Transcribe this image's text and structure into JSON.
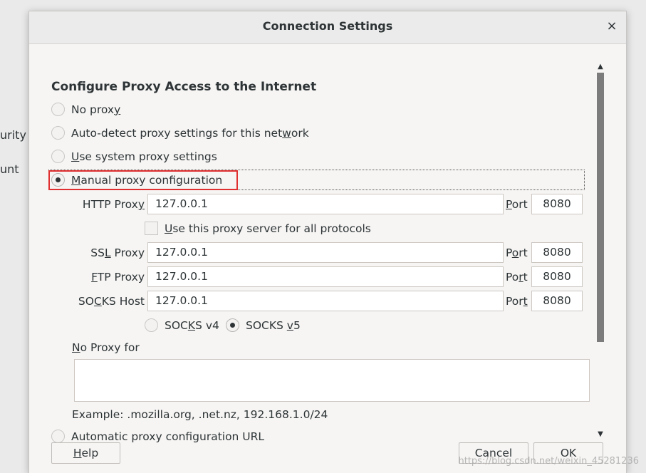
{
  "background": {
    "partial_text_1": "urity",
    "partial_text_2": "unt"
  },
  "dialog": {
    "title": "Connection Settings",
    "close_glyph": "×"
  },
  "heading": "Configure Proxy Access to the Internet",
  "radios": {
    "no_proxy": {
      "pre": "No prox",
      "mn": "y",
      "post": "",
      "checked": false
    },
    "auto_detect": {
      "pre": "Auto-detect proxy settings for this net",
      "mn": "w",
      "post": "ork",
      "checked": false
    },
    "use_system": {
      "pre": "",
      "mn": "U",
      "post": "se system proxy settings",
      "checked": false
    },
    "manual": {
      "pre": "",
      "mn": "M",
      "post": "anual proxy configuration",
      "checked": true
    },
    "auto_url": {
      "pre": "",
      "mn": "",
      "post": "Automatic proxy configuration URL",
      "checked": false
    }
  },
  "proxies": {
    "http": {
      "label_pre": "HTTP Prox",
      "label_mn": "y",
      "value": "127.0.0.1",
      "port": "8080"
    },
    "ssl": {
      "label_pre": "SS",
      "label_mn": "L",
      "label_post": " Proxy",
      "value": "127.0.0.1",
      "port": "8080"
    },
    "ftp": {
      "label_mn": "F",
      "label_post": "TP Proxy",
      "value": "127.0.0.1",
      "port": "8080"
    },
    "socks": {
      "label_pre": "SO",
      "label_mn": "C",
      "label_post": "KS Host",
      "value": "127.0.0.1",
      "port": "8080"
    }
  },
  "port_label": {
    "pre": "P",
    "mn": "o",
    "post": "rt"
  },
  "port_labels": {
    "http": {
      "mn": "P",
      "post": "ort"
    },
    "ssl": {
      "pre": "P",
      "mn": "o",
      "post": "rt"
    },
    "ftp": {
      "pre": "Po",
      "mn": "r",
      "post": "t"
    },
    "socks": {
      "pre": "Por",
      "mn": "t",
      "post": ""
    }
  },
  "use_for_all": {
    "pre": "",
    "mn": "U",
    "post": "se this proxy server for all protocols",
    "checked": false
  },
  "socks_versions": {
    "v4": {
      "pre": "SOC",
      "mn": "K",
      "post": "S v4",
      "checked": false
    },
    "v5": {
      "pre": "SOCKS ",
      "mn": "v",
      "post": "5",
      "checked": true
    }
  },
  "no_proxy_for": {
    "mn": "N",
    "post": "o Proxy for",
    "value": ""
  },
  "example": "Example: .mozilla.org, .net.nz, 192.168.1.0/24",
  "buttons": {
    "help": {
      "mn": "H",
      "post": "elp"
    },
    "cancel": "Cancel",
    "ok": "OK"
  },
  "scrollbar": {
    "up": "▲",
    "down": "▼"
  },
  "watermark": "https://blog.csdn.net/weixin_45281236",
  "colors": {
    "highlight_box": "#e03030",
    "scroll_thumb": "#7c7c7c"
  }
}
